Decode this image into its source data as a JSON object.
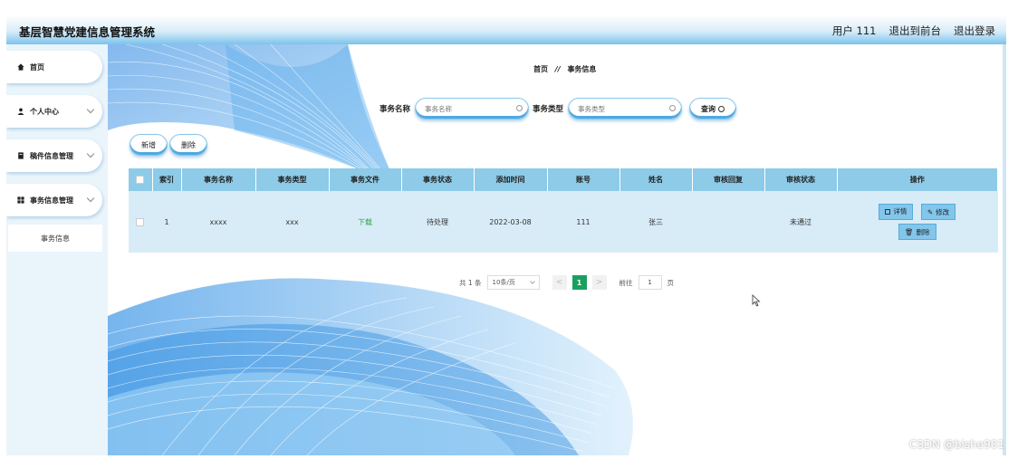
{
  "header": {
    "app_title": "基层智慧党建信息管理系统",
    "user_label": "用户 111",
    "back_to_front": "退出到前台",
    "logout": "退出登录"
  },
  "sidebar": {
    "items": [
      {
        "label": "首页",
        "icon": "home-icon"
      },
      {
        "label": "个人中心",
        "icon": "user-icon"
      },
      {
        "label": "稿件信息管理",
        "icon": "document-icon"
      },
      {
        "label": "事务信息管理",
        "icon": "grid-icon"
      }
    ],
    "submenu": {
      "label": "事务信息"
    }
  },
  "breadcrumb": {
    "home": "首页",
    "separator": "//",
    "current": "事务信息"
  },
  "search": {
    "name_label": "事务名称",
    "name_placeholder": "事务名称",
    "type_label": "事务类型",
    "type_placeholder": "事务类型",
    "query_button": "查询"
  },
  "actions": {
    "add": "新增",
    "delete": "删除"
  },
  "table": {
    "columns": [
      "索引",
      "事务名称",
      "事务类型",
      "事务文件",
      "事务状态",
      "添加时间",
      "账号",
      "姓名",
      "审核回复",
      "审核状态",
      "操作"
    ],
    "rows": [
      {
        "index": "1",
        "name": "xxxx",
        "type": "xxx",
        "file": "下载",
        "status": "待处理",
        "added": "2022-03-08",
        "account": "111",
        "person": "张三",
        "reply": "",
        "review": "未通过",
        "ops": {
          "detail": "详情",
          "edit": "修改",
          "delete": "删除"
        }
      }
    ]
  },
  "pagination": {
    "total": "共 1 条",
    "page_size": "10条/页",
    "prev": "<",
    "current_page": "1",
    "next": ">",
    "goto_label": "前往",
    "goto_value": "1",
    "page_unit": "页"
  },
  "watermark": "CSDN @bishe901",
  "colors": {
    "accent": "#4ea9e0",
    "header_row": "#8dcbe8",
    "body_row": "#d8ecf7",
    "active_page": "#1aa05e",
    "download_link": "#28a745"
  }
}
